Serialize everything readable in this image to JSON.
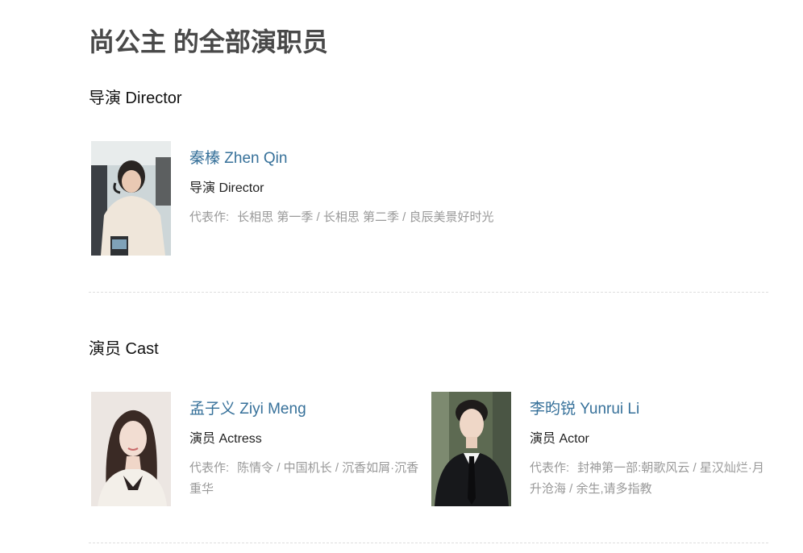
{
  "page": {
    "title": "尚公主 的全部演职员"
  },
  "sections": {
    "director": {
      "heading": "导演 Director",
      "people": [
        {
          "name": "秦榛 Zhen Qin",
          "role": "导演 Director",
          "works_label": "代表作:",
          "works_text": "长相思 第一季 / 长相思 第二季 / 良辰美景好时光"
        }
      ]
    },
    "cast": {
      "heading": "演员 Cast",
      "people": [
        {
          "name": "孟子义 Ziyi Meng",
          "role": "演员 Actress",
          "works_label": "代表作:",
          "works_text": "陈情令 / 中国机长 / 沉香如屑·沉香重华"
        },
        {
          "name": "李昀锐 Yunrui Li",
          "role": "演员 Actor",
          "works_label": "代表作:",
          "works_text": "封神第一部:朝歌风云 / 星汉灿烂·月升沧海 / 余生,请多指教"
        }
      ]
    }
  },
  "colors": {
    "link": "#37719a",
    "muted": "#999999",
    "title": "#494949",
    "divider": "#dddddd"
  },
  "icons": {
    "director_photo": "person-photo",
    "cast_photo_1": "person-photo",
    "cast_photo_2": "person-photo"
  }
}
